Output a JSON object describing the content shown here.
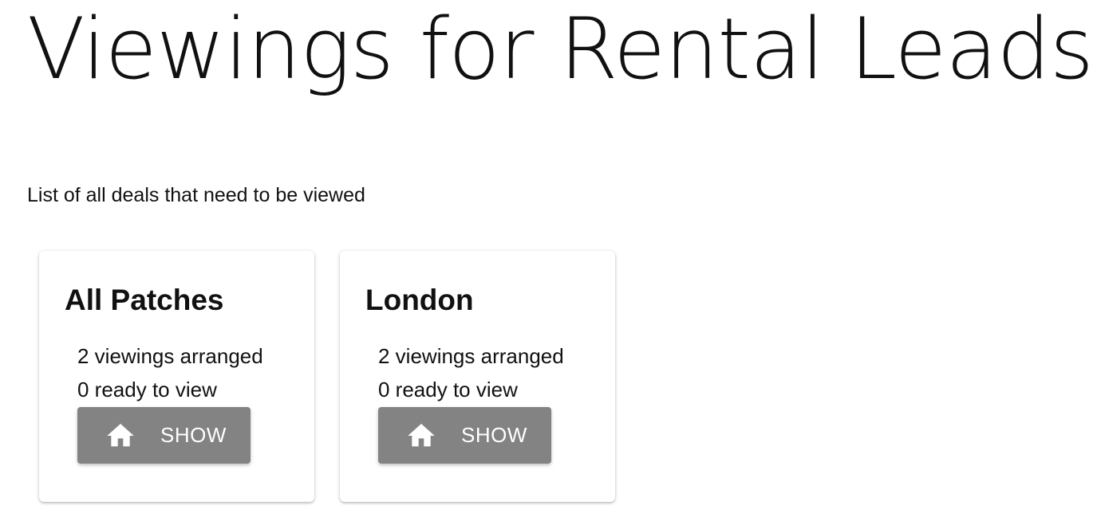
{
  "header": {
    "title": "Viewings for Rental Leads",
    "subtitle": "List of all deals that need to be viewed"
  },
  "cards": [
    {
      "title": "All Patches",
      "arranged": "2 viewings arranged",
      "ready": "0 ready to view",
      "button_label": "SHOW",
      "button_icon": "home-icon"
    },
    {
      "title": "London",
      "arranged": "2 viewings arranged",
      "ready": "0 ready to view",
      "button_label": "SHOW",
      "button_icon": "home-icon"
    }
  ],
  "colors": {
    "button_background": "#838383",
    "button_text": "#ffffff",
    "text": "#111111",
    "background": "#ffffff"
  }
}
